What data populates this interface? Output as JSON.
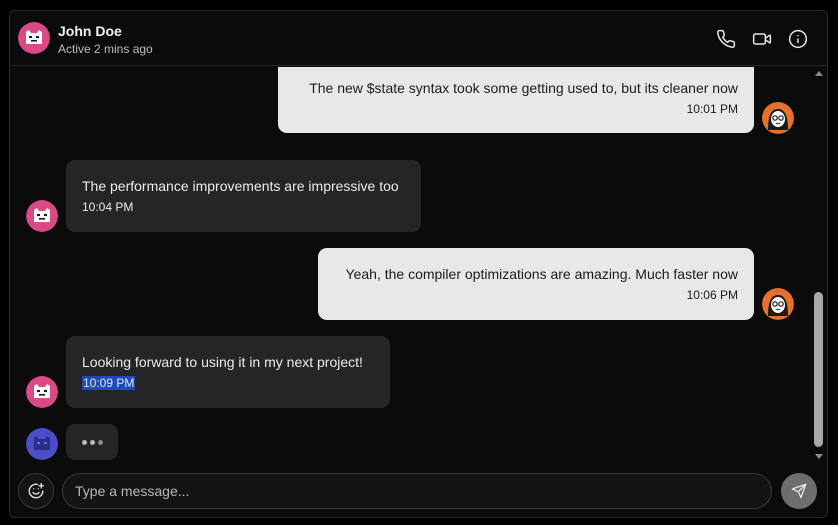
{
  "header": {
    "contact_name": "John Doe",
    "status": "Active 2 mins ago",
    "contact_avatar": "robot-avatar-icon",
    "actions": [
      "phone-icon",
      "video-camera-icon",
      "info-icon"
    ]
  },
  "messages": [
    {
      "direction": "outgoing",
      "text": "The new $state syntax took some getting used to, but its cleaner now",
      "time": "10:01 PM",
      "avatar": "user-avatar-icon"
    },
    {
      "direction": "incoming",
      "text": "The performance improvements are impressive too",
      "time": "10:04 PM",
      "avatar": "robot-avatar-icon"
    },
    {
      "direction": "outgoing",
      "text": "Yeah, the compiler optimizations are amazing. Much faster now",
      "time": "10:06 PM",
      "avatar": "user-avatar-icon"
    },
    {
      "direction": "incoming",
      "text": "Looking forward to using it in my next project!",
      "time": "10:09 PM",
      "avatar": "robot-avatar-icon",
      "time_selected": true
    }
  ],
  "typing_indicator": {
    "avatar": "robot-avatar-blue-icon",
    "visible": true
  },
  "composer": {
    "placeholder": "Type a message...",
    "value": "",
    "emoji_button": "emoji-add-icon",
    "send_button": "send-icon"
  },
  "colors": {
    "background": "#0b0b0b",
    "incoming_bubble": "#252527",
    "outgoing_bubble": "#e8e8e8",
    "robot_avatar": "#d94a86",
    "user_avatar": "#e8702a",
    "typing_avatar": "#4a4fc8",
    "selection": "#1d4cb8"
  }
}
